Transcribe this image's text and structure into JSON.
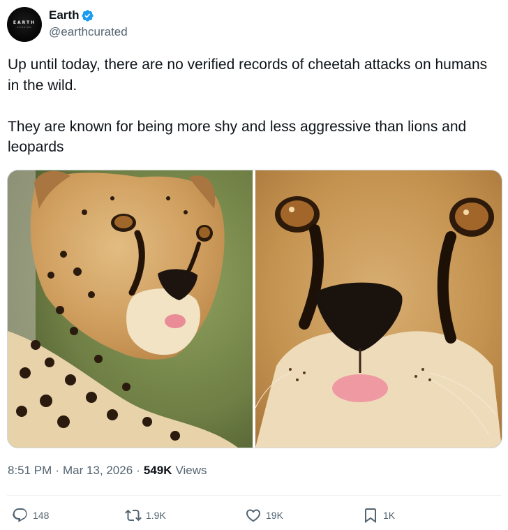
{
  "author": {
    "display_name": "Earth",
    "handle": "@earthcurated",
    "verified": true,
    "avatar_logo_text": "EARTH",
    "avatar_logo_sub": "CURATED"
  },
  "post": {
    "paragraphs": [
      "Up until today, there are no verified records of cheetah attacks on humans in the wild.",
      "They are known for being more shy and less aggressive than lions and leopards"
    ]
  },
  "media": {
    "images": [
      {
        "subject": "cheetah-portrait-side-view"
      },
      {
        "subject": "cheetah-face-closeup"
      }
    ]
  },
  "meta": {
    "time": "8:51 PM",
    "separator": "·",
    "date": "Mar 13, 2026",
    "views_count": "549K",
    "views_label": "Views"
  },
  "actions": {
    "reply_count": "148",
    "retweet_count": "1.9K",
    "like_count": "19K",
    "bookmark_count": "1K"
  },
  "colors": {
    "text_primary": "#0f1419",
    "text_secondary": "#536471",
    "verified_blue": "#1d9bf0",
    "divider": "#eff3f4"
  },
  "icons": {
    "reply": "reply-icon",
    "retweet": "retweet-icon",
    "like": "heart-icon",
    "bookmark": "bookmark-icon",
    "verified": "verified-badge-icon"
  }
}
